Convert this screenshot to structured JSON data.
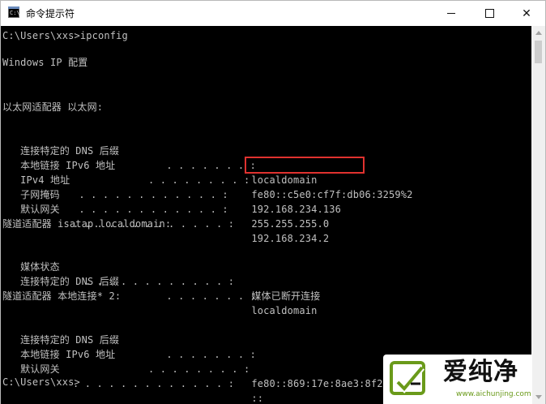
{
  "window": {
    "title": "命令提示符",
    "app_icon_text": "C:\\",
    "minimize_icon": "minimize-icon",
    "maximize_icon": "maximize-icon",
    "close_icon": "close-icon",
    "close_glyph": "✕"
  },
  "console": {
    "prompt1": "C:\\Users\\xxs>ipconfig",
    "header": "Windows IP 配置",
    "adapter1_title": "以太网适配器 以太网:",
    "adapter1": [
      {
        "label": "   连接特定的 DNS 后缀",
        "dots": " . . . . . . . :",
        "value": " localdomain"
      },
      {
        "label": "   本地链接 IPv6 地址",
        "dots": ". . . . . . . . :",
        "value": " fe80::c5e0:cf7f:db06:3259%2"
      },
      {
        "label": "   IPv4 地址",
        "dots": " . . . . . . . . . . . . :",
        "value": " 192.168.234.136"
      },
      {
        "label": "   子网掩码",
        "dots": " . . . . . . . . . . . . :",
        "value": " 255.255.255.0"
      },
      {
        "label": "   默认网关",
        "dots": ". . . . . . . . . . . . . :",
        "value": " 192.168.234.2"
      }
    ],
    "adapter2_title": "隧道适配器 isatap.localdomain:",
    "adapter2": [
      {
        "label": "   媒体状态",
        "dots": "  . . . . . . . . . . . . :",
        "value": " 媒体已断开连接"
      },
      {
        "label": "   连接特定的 DNS 后缀",
        "dots": " . . . . . . . :",
        "value": " localdomain"
      }
    ],
    "adapter3_title": "隧道适配器 本地连接* 2:",
    "adapter3": [
      {
        "label": "   连接特定的 DNS 后缀",
        "dots": " . . . . . . . :",
        "value": ""
      },
      {
        "label": "   本地链接 IPv6 地址",
        "dots": ". . . . . . . . :",
        "value": " fe80::869:17e:8ae3:8f27%13"
      },
      {
        "label": "   默认网关",
        "dots": ". . . . . . . . . . . . . :",
        "value": " ::"
      }
    ],
    "prompt2": "C:\\Users\\xxs>",
    "colors": {
      "background": "#000000",
      "text": "#c0c0c0",
      "highlight_border": "#e0322f"
    }
  },
  "watermark": {
    "brand_text": "爱纯净",
    "url": "www.aichunjing.com",
    "logo_icon": "aichunjing-logo-icon",
    "brand_color": "#6a9a1a"
  }
}
